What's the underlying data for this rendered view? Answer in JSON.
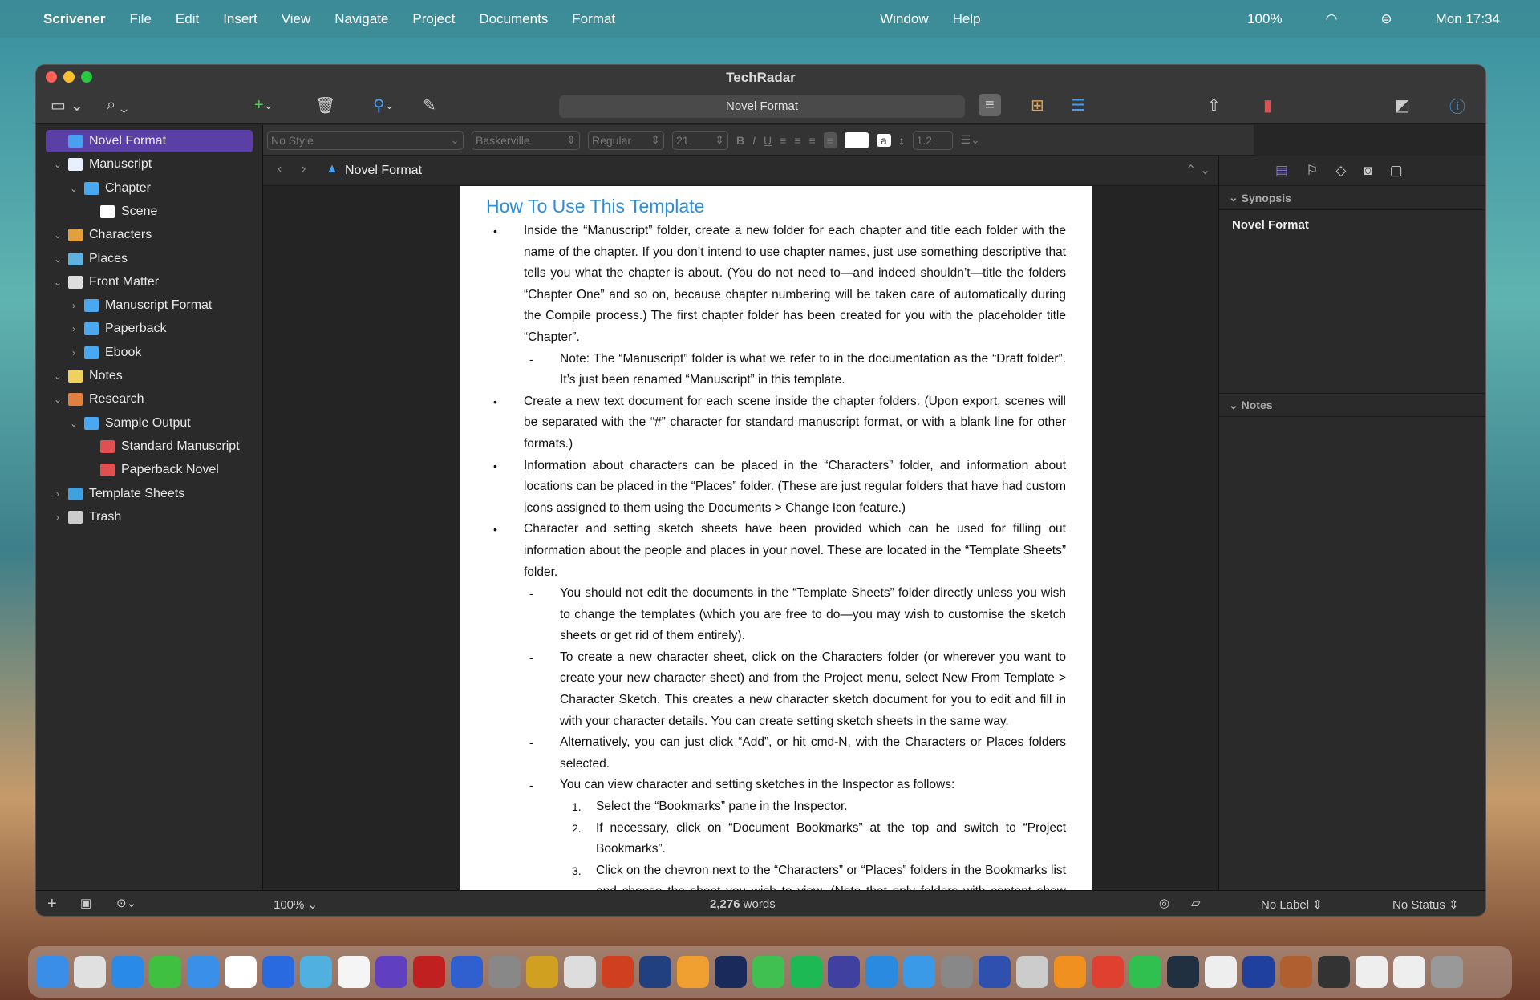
{
  "menubar": {
    "app": "Scrivener",
    "items": [
      "File",
      "Edit",
      "Insert",
      "View",
      "Navigate",
      "Project",
      "Documents",
      "Format"
    ],
    "items_right": [
      "Window",
      "Help"
    ],
    "battery": "100%",
    "clock": "Mon  17:34"
  },
  "window": {
    "title": "TechRadar",
    "search_text": "Novel Format"
  },
  "format_bar": {
    "style": "No Style",
    "font": "Baskerville",
    "weight": "Regular",
    "size": "21",
    "bold": "B",
    "italic": "I",
    "underline": "U",
    "highlight": "a",
    "line_spacing": "1.2"
  },
  "binder": [
    {
      "label": "Novel Format",
      "level": 0,
      "chev": "",
      "icon": "warning-doc",
      "color": "#4aa0f0",
      "selected": true
    },
    {
      "label": "Manuscript",
      "level": 0,
      "chev": "v",
      "icon": "manuscript",
      "color": "#e8f0ff"
    },
    {
      "label": "Chapter",
      "level": 1,
      "chev": "v",
      "icon": "folder",
      "color": "#4aa8f0"
    },
    {
      "label": "Scene",
      "level": 2,
      "chev": "",
      "icon": "document",
      "color": "#ffffff"
    },
    {
      "label": "Characters",
      "level": 0,
      "chev": "v",
      "icon": "characters",
      "color": "#e0a040"
    },
    {
      "label": "Places",
      "level": 0,
      "chev": "v",
      "icon": "places",
      "color": "#60b0e0"
    },
    {
      "label": "Front Matter",
      "level": 0,
      "chev": "v",
      "icon": "front-matter",
      "color": "#dddddd"
    },
    {
      "label": "Manuscript Format",
      "level": 1,
      "chev": ">",
      "icon": "folder",
      "color": "#4aa8f0"
    },
    {
      "label": "Paperback",
      "level": 1,
      "chev": ">",
      "icon": "folder",
      "color": "#4aa8f0"
    },
    {
      "label": "Ebook",
      "level": 1,
      "chev": ">",
      "icon": "folder",
      "color": "#4aa8f0"
    },
    {
      "label": "Notes",
      "level": 0,
      "chev": "v",
      "icon": "notes",
      "color": "#f0d060"
    },
    {
      "label": "Research",
      "level": 0,
      "chev": "v",
      "icon": "research",
      "color": "#e08040"
    },
    {
      "label": "Sample Output",
      "level": 1,
      "chev": "v",
      "icon": "folder",
      "color": "#4aa8f0"
    },
    {
      "label": "Standard Manuscript",
      "level": 2,
      "chev": "",
      "icon": "pdf",
      "color": "#e05050"
    },
    {
      "label": "Paperback Novel",
      "level": 2,
      "chev": "",
      "icon": "pdf",
      "color": "#e05050"
    },
    {
      "label": "Template Sheets",
      "level": 0,
      "chev": ">",
      "icon": "template",
      "color": "#40a0e0"
    },
    {
      "label": "Trash",
      "level": 0,
      "chev": ">",
      "icon": "trash",
      "color": "#cccccc"
    }
  ],
  "editor": {
    "header_title": "Novel Format",
    "doc_title": "How To Use This Template",
    "paragraphs": [
      {
        "m": "•",
        "l": 0,
        "t": "Inside the “Manuscript” folder, create a new folder for each chapter and title each folder with the name of the chapter. If you don’t intend to use chapter names, just use something descriptive that tells you what the chapter is about. (You do not need to—and indeed shouldn’t—title the folders “Chapter One” and so on, because chapter numbering will be taken care of automatically during the Compile process.) The first chapter folder has been created for you with the placeholder title “Chapter”."
      },
      {
        "m": "-",
        "l": 1,
        "t": "Note: The “Manuscript” folder is what we refer to in the documentation as the “Draft folder”. It’s just been renamed “Manuscript” in this template."
      },
      {
        "m": "•",
        "l": 0,
        "t": "Create a new text document for each scene inside the chapter folders. (Upon export, scenes will be separated with the “#” character for standard manuscript format, or with a blank line for other formats.)"
      },
      {
        "m": "•",
        "l": 0,
        "t": "Information about characters can be placed in the “Characters” folder, and information about locations can be placed in the “Places” folder. (These are just regular folders that have had custom icons assigned to them using the Documents > Change Icon feature.)"
      },
      {
        "m": "•",
        "l": 0,
        "t": "Character and setting sketch sheets have been provided which can be used for filling out information about the people and places in your novel. These are located in the “Template Sheets” folder."
      },
      {
        "m": "-",
        "l": 1,
        "t": "You should not edit the documents in the “Template Sheets” folder directly unless you wish to change the templates (which you are free to do—you may wish to customise the sketch sheets or get rid of them entirely)."
      },
      {
        "m": "-",
        "l": 1,
        "t": "To create a new character sheet, click on the Characters folder (or wherever you want to create your new character sheet) and from the Project menu, select New From Template > Character Sketch. This creates a new character sketch document for you to edit and fill in with your character details. You can create setting sketch sheets in the same way."
      },
      {
        "m": "-",
        "l": 1,
        "t": "Alternatively, you can just click “Add”, or hit cmd-N, with the Characters or Places folders selected."
      },
      {
        "m": "-",
        "l": 1,
        "t": "You can view character and setting sketches in the Inspector as follows:"
      },
      {
        "m": "1.",
        "l": 2,
        "t": "Select the “Bookmarks” pane in the Inspector."
      },
      {
        "m": "2.",
        "l": 2,
        "t": "If necessary, click on “Document Bookmarks” at the top and switch to “Project Bookmarks”."
      },
      {
        "m": "3.",
        "l": 2,
        "t": "Click on the chevron next to the “Characters” or “Places” folders in the Bookmarks list and choose the sheet you wish to view. (Note that only folders with content show chevrons.)"
      }
    ]
  },
  "inspector": {
    "synopsis_label": "Synopsis",
    "synopsis_title": "Novel Format",
    "notes_label": "Notes"
  },
  "footer": {
    "zoom": "100%",
    "word_count": "2,276",
    "words_label": "words",
    "label": "No Label",
    "status": "No Status"
  },
  "colors": {
    "accent": "#5a3fa6",
    "title_blue": "#2a8de0"
  }
}
